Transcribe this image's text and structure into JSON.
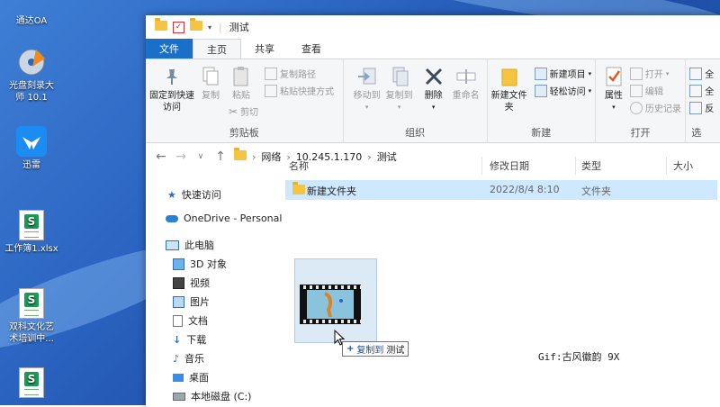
{
  "desktop": {
    "icons": [
      {
        "label": "通达OA",
        "icon": "oa-icon"
      },
      {
        "label": "光盘刻录大师 10.1",
        "icon": "disc-burner-icon"
      },
      {
        "label": "迅雷",
        "icon": "thunder-bird-icon"
      },
      {
        "label": "工作簿1.xlsx",
        "icon": "spreadsheet-icon"
      },
      {
        "label": "双科文化艺术培训中...",
        "icon": "spreadsheet-icon"
      },
      {
        "label": "",
        "icon": "spreadsheet-icon"
      }
    ]
  },
  "window": {
    "title": "测试",
    "tabs": [
      "文件",
      "主页",
      "共享",
      "查看"
    ],
    "active_tab": "主页",
    "ribbon": {
      "clipboard": {
        "pin": "固定到快速访问",
        "copy": "复制",
        "paste": "粘贴",
        "copy_path": "复制路径",
        "paste_shortcut": "粘贴快捷方式",
        "cut": "剪切",
        "label": "剪贴板"
      },
      "organize": {
        "move_to": "移动到",
        "copy_to": "复制到",
        "delete": "删除",
        "rename": "重命名",
        "label": "组织"
      },
      "new": {
        "new_folder": "新建文件夹",
        "new_item": "新建项目",
        "easy_access": "轻松访问",
        "label": "新建"
      },
      "open": {
        "properties": "属性",
        "open": "打开",
        "edit": "编辑",
        "history": "历史记录",
        "label": "打开"
      },
      "select": {
        "a": "全",
        "b": "全",
        "c": "反",
        "label": "选"
      }
    },
    "address": {
      "crumbs": [
        "网络",
        "10.245.1.170",
        "测试"
      ]
    },
    "nav": {
      "quick_access": "快速访问",
      "onedrive": "OneDrive - Personal",
      "this_pc": "此电脑",
      "items": [
        "3D 对象",
        "视频",
        "图片",
        "文档",
        "下载",
        "音乐",
        "桌面",
        "本地磁盘 (C:)"
      ]
    },
    "columns": [
      "名称",
      "修改日期",
      "类型",
      "大小"
    ],
    "files": [
      {
        "name": "新建文件夹",
        "date": "2022/8/4 8:10",
        "type": "文件夹",
        "size": ""
      }
    ]
  },
  "drag": {
    "tooltip_action": "复制到",
    "tooltip_target": "测试"
  },
  "watermark": "Gif:古风徽韵  9X",
  "colors": {
    "file_tab": "#1a6fc9",
    "selected_row": "#cde8ff",
    "folder": "#f5c542"
  }
}
